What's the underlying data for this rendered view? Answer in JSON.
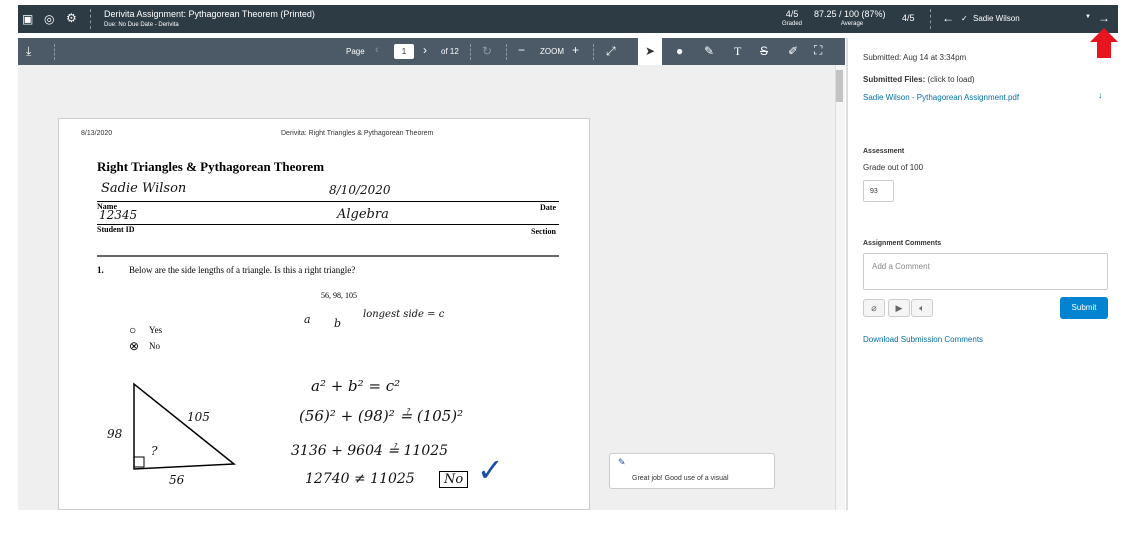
{
  "header": {
    "title": "Derivita Assignment: Pythagorean Theorem (Printed)",
    "due": "Due: No Due Date - Derivita",
    "graded_value": "4/5",
    "graded_label": "Graded",
    "average_value": "87.25 / 100 (87%)",
    "average_label": "Average",
    "position": "4/5",
    "student": "Sadie Wilson"
  },
  "toolbar": {
    "page_label": "Page",
    "page_value": "1",
    "page_total": "of 12",
    "zoom_label": "ZOOM"
  },
  "document": {
    "date": "8/13/2020",
    "running_title": "Derivita: Right Triangles & Pythagorean Theorem",
    "title": "Right Triangles & Pythagorean Theorem",
    "name_label": "Name",
    "date_label": "Date",
    "student_id_label": "Student ID",
    "section_label": "Section",
    "question_number": "1.",
    "question": "Below are the side lengths of a triangle. Is this a right triangle?",
    "lengths": "56, 98, 105",
    "option_yes": "Yes",
    "option_no": "No",
    "handwriting": {
      "name": "Sadie Wilson",
      "date": "8/10/2020",
      "student_id": "12345",
      "section": "Algebra",
      "labels_a": "a",
      "labels_b": "b",
      "longest": "longest side = c",
      "eq1": "a² + b² = c²",
      "eq2": "(56)² + (98)² ≟ (105)²",
      "eq3": "3136 + 9604 ≟ 11025",
      "eq4": "12740 ≠ 11025",
      "answer": "No",
      "side_98": "98",
      "side_105": "105",
      "side_56": "56",
      "unknown": "?"
    }
  },
  "annotation": {
    "comment": "Great job! Good use of a visual"
  },
  "sidebar": {
    "submitted": "Submitted: Aug 14 at 3:34pm",
    "files_label": "Submitted Files:",
    "files_hint": "(click to load)",
    "file_name": "Sadie Wilson - Pythagorean Assignment.pdf",
    "assessment_label": "Assessment",
    "grade_out_of": "Grade out of 100",
    "grade_value": "93",
    "comments_label": "Assignment Comments",
    "comment_placeholder": "Add a Comment",
    "submit_label": "Submit",
    "download_comments": "Download Submission Comments"
  },
  "colors": {
    "header_bg": "#2d3b45",
    "toolbar_bg": "#4b5a66",
    "link": "#0770a3",
    "submit": "#0084d1",
    "arrow": "#e8141e",
    "check": "#1a4fa8"
  }
}
